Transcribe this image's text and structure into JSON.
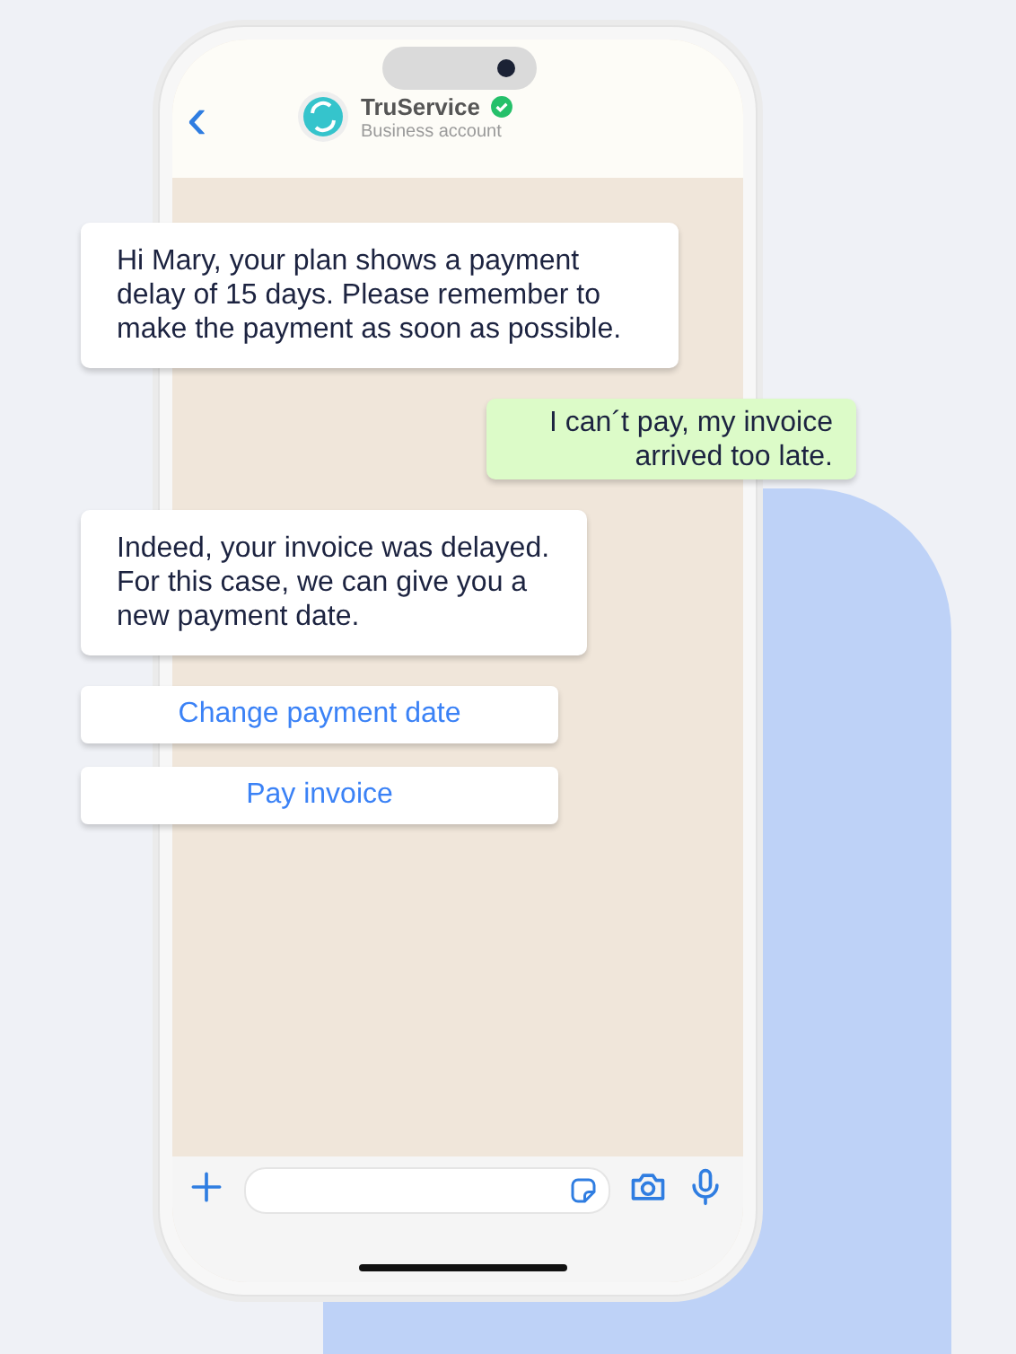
{
  "header": {
    "back": "‹",
    "name": "TruService",
    "verified": true,
    "subtitle": "Business account"
  },
  "messages": [
    {
      "kind": "incoming",
      "text": "Hi Mary, your plan shows a payment delay of 15 days. Please remember to make the payment as soon as possible."
    },
    {
      "kind": "outgoing",
      "text": "I can´t pay, my invoice arrived too late."
    },
    {
      "kind": "incoming",
      "text": "Indeed, your invoice was delayed. For this case, we can give you a new payment date."
    }
  ],
  "quick_replies": [
    "Change payment date",
    "Pay invoice"
  ]
}
